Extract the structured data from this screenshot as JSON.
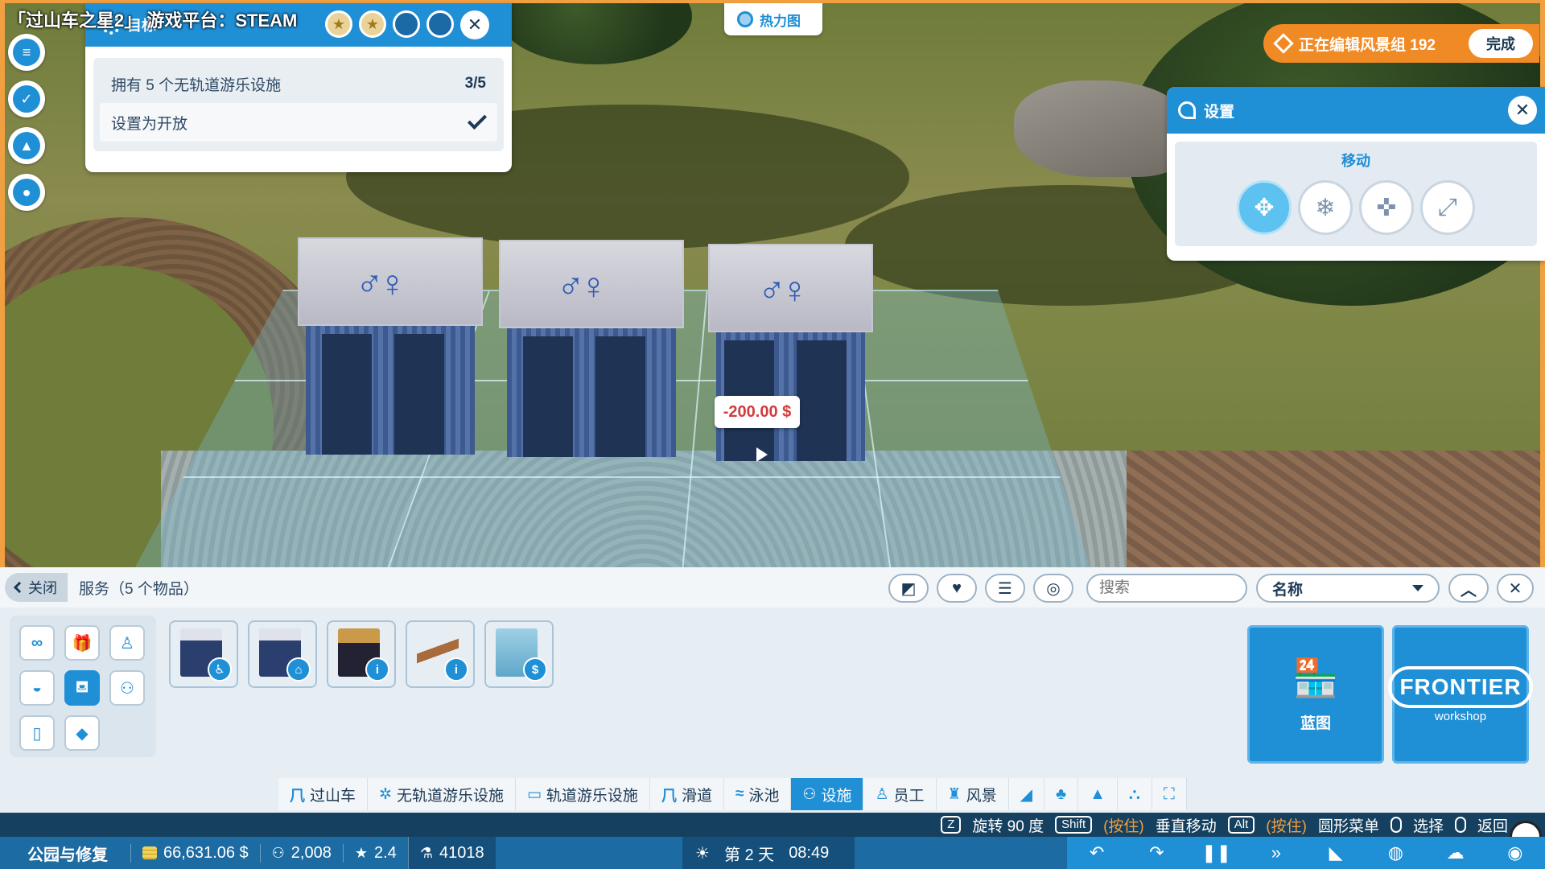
{
  "overlay": {
    "stream_title": "「过山车之星2」 游戏平台：STEAM"
  },
  "side_icons": [
    {
      "name": "objectives-icon",
      "glyph": "≡"
    },
    {
      "name": "goals-check-icon",
      "glyph": "✓"
    },
    {
      "name": "terrain-add-icon",
      "glyph": "▲"
    },
    {
      "name": "notifications-bell-icon",
      "glyph": "●"
    }
  ],
  "objective": {
    "title": "目标",
    "row_main": {
      "label": "拥有 5 个无轨道游乐设施",
      "count": "3/5"
    },
    "row_sub": {
      "label": "设置为开放"
    }
  },
  "heatmap": {
    "label": "热力图"
  },
  "edit_banner": {
    "text": "正在编辑风景组 192",
    "done_label": "完成"
  },
  "settings_panel": {
    "title": "设置",
    "section": "移动",
    "buttons": [
      {
        "name": "move-free-button",
        "glyph": "✥"
      },
      {
        "name": "move-snap-button",
        "glyph": "❄"
      },
      {
        "name": "move-axis-button",
        "glyph": "✜"
      },
      {
        "name": "move-scale-button",
        "glyph": "⤢"
      }
    ]
  },
  "scene": {
    "price_tag": "-200.00 $"
  },
  "build_panel": {
    "close_label": "关闭",
    "category": "服务（5 个物品）",
    "search_placeholder": "搜索",
    "sort_label": "名称",
    "tool_buttons": [
      {
        "name": "blueprint-toggle-button",
        "glyph": "◩"
      },
      {
        "name": "favorites-button",
        "glyph": "♥"
      },
      {
        "name": "filters-button",
        "glyph": "☰"
      },
      {
        "name": "theme-button",
        "glyph": "◎"
      }
    ],
    "subcategories": [
      {
        "name": "subcat-all-icon",
        "glyph": "∞"
      },
      {
        "name": "subcat-gift-icon",
        "glyph": "🎁"
      },
      {
        "name": "subcat-staff-icon",
        "glyph": "♙"
      },
      {
        "name": "subcat-food-icon",
        "glyph": "◒"
      },
      {
        "name": "subcat-facilities-icon",
        "glyph": "⛾"
      },
      {
        "name": "subcat-guests-icon",
        "glyph": "⚇"
      },
      {
        "name": "subcat-drink-icon",
        "glyph": "▯"
      },
      {
        "name": "subcat-water-icon",
        "glyph": "◆"
      }
    ],
    "items": [
      {
        "name": "item-toilet-block",
        "badge": "♿"
      },
      {
        "name": "item-changing-room",
        "badge": "⌂"
      },
      {
        "name": "item-info-kiosk",
        "badge": "i"
      },
      {
        "name": "item-info-desk",
        "badge": "i"
      },
      {
        "name": "item-atm",
        "badge": "$"
      }
    ],
    "blueprint_label": "蓝图",
    "workshop": {
      "logo": "FRONTIER",
      "sub": "workshop"
    },
    "bottom_tabs": [
      {
        "label": "过山车",
        "icon": "⺇"
      },
      {
        "label": "无轨道游乐设施",
        "icon": "✲"
      },
      {
        "label": "轨道游乐设施",
        "icon": "▭"
      },
      {
        "label": "滑道",
        "icon": "⺇"
      },
      {
        "label": "泳池",
        "icon": "≈"
      },
      {
        "label": "设施",
        "icon": "⚇"
      },
      {
        "label": "员工",
        "icon": "♙"
      },
      {
        "label": "风景",
        "icon": "♜"
      }
    ],
    "extra_tabs": [
      "◢",
      "♣",
      "▲",
      "⛬",
      "⛶"
    ]
  },
  "hotkeys": {
    "rotate_key": "Z",
    "rotate_label": "旋转 90 度",
    "shift_key": "Shift",
    "hold_label": "(按住)",
    "vertical_label": "垂直移动",
    "alt_key": "Alt",
    "radial_label": "圆形菜单",
    "select_label": "选择",
    "back_label": "返回"
  },
  "status": {
    "park_label": "公园与修复",
    "money": "66,631.06 $",
    "guests": "2,008",
    "rating": "2.4",
    "research": "41018",
    "day": "第 2 天",
    "time": "08:49"
  },
  "colors": {
    "accent": "#1f8fd6",
    "orange": "#f08a24",
    "dark": "#1c3a55"
  }
}
